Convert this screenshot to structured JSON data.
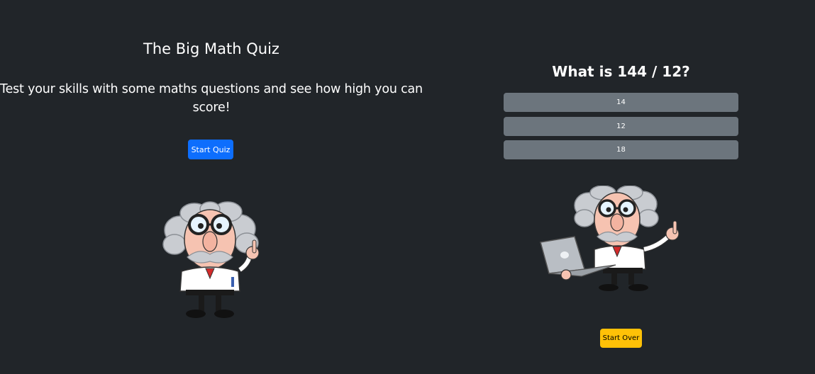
{
  "intro": {
    "title": "The Big Math Quiz",
    "subtitle": "Test your skills with some maths questions and see how high you can score!",
    "start_label": "Start Quiz",
    "image_name": "professor-icon"
  },
  "quiz": {
    "question": "What is 144 / 12?",
    "answers": [
      {
        "label": "14"
      },
      {
        "label": "12"
      },
      {
        "label": "18"
      }
    ],
    "start_over_label": "Start Over",
    "image_name": "professor-laptop-icon"
  },
  "colors": {
    "background": "#212529",
    "primary": "#0d6efd",
    "secondary": "#6c757d",
    "warning": "#ffc107"
  }
}
